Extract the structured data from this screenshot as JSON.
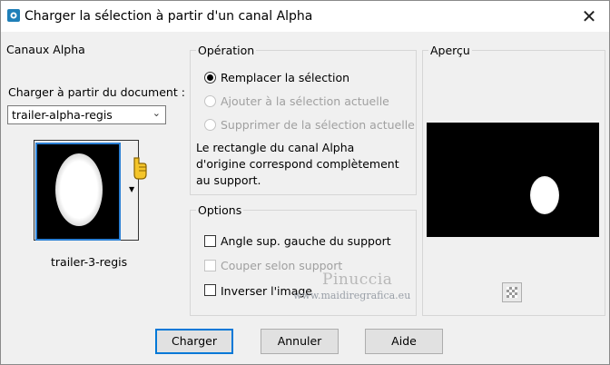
{
  "window": {
    "title": "Charger la sélection à partir d'un canal Alpha",
    "close_glyph": "✕"
  },
  "canaux": {
    "group_label": "Canaux Alpha",
    "source_label": "Charger à partir du document :",
    "document_value": "trailer-alpha-regis",
    "channel_name": "trailer-3-regis"
  },
  "operation": {
    "group_label": "Opération",
    "radios": [
      {
        "label": "Remplacer la sélection",
        "selected": true,
        "enabled": true
      },
      {
        "label": "Ajouter à la sélection actuelle",
        "selected": false,
        "enabled": false
      },
      {
        "label": "Supprimer de la sélection actuelle",
        "selected": false,
        "enabled": false
      }
    ],
    "info_lines": [
      "Le rectangle du canal Alpha",
      "d'origine correspond complètement",
      "au support."
    ]
  },
  "options": {
    "group_label": "Options",
    "checks": [
      {
        "label": "Angle sup. gauche du support",
        "checked": false,
        "enabled": true
      },
      {
        "label": "Couper selon support",
        "checked": false,
        "enabled": false
      },
      {
        "label": "Inverser l'image",
        "checked": false,
        "enabled": true
      }
    ]
  },
  "apercu": {
    "group_label": "Aperçu"
  },
  "watermark": {
    "name": "Pinuccia",
    "url": "www.maidiregrafica.eu"
  },
  "buttons": {
    "load": "Charger",
    "cancel": "Annuler",
    "help": "Aide"
  },
  "colors": {
    "accent": "#0078d7",
    "selection_border": "#2a7fd4"
  },
  "icons": [
    "app-icon",
    "close-icon",
    "chevron-down-icon",
    "hand-pointer-icon",
    "transparency-icon"
  ]
}
